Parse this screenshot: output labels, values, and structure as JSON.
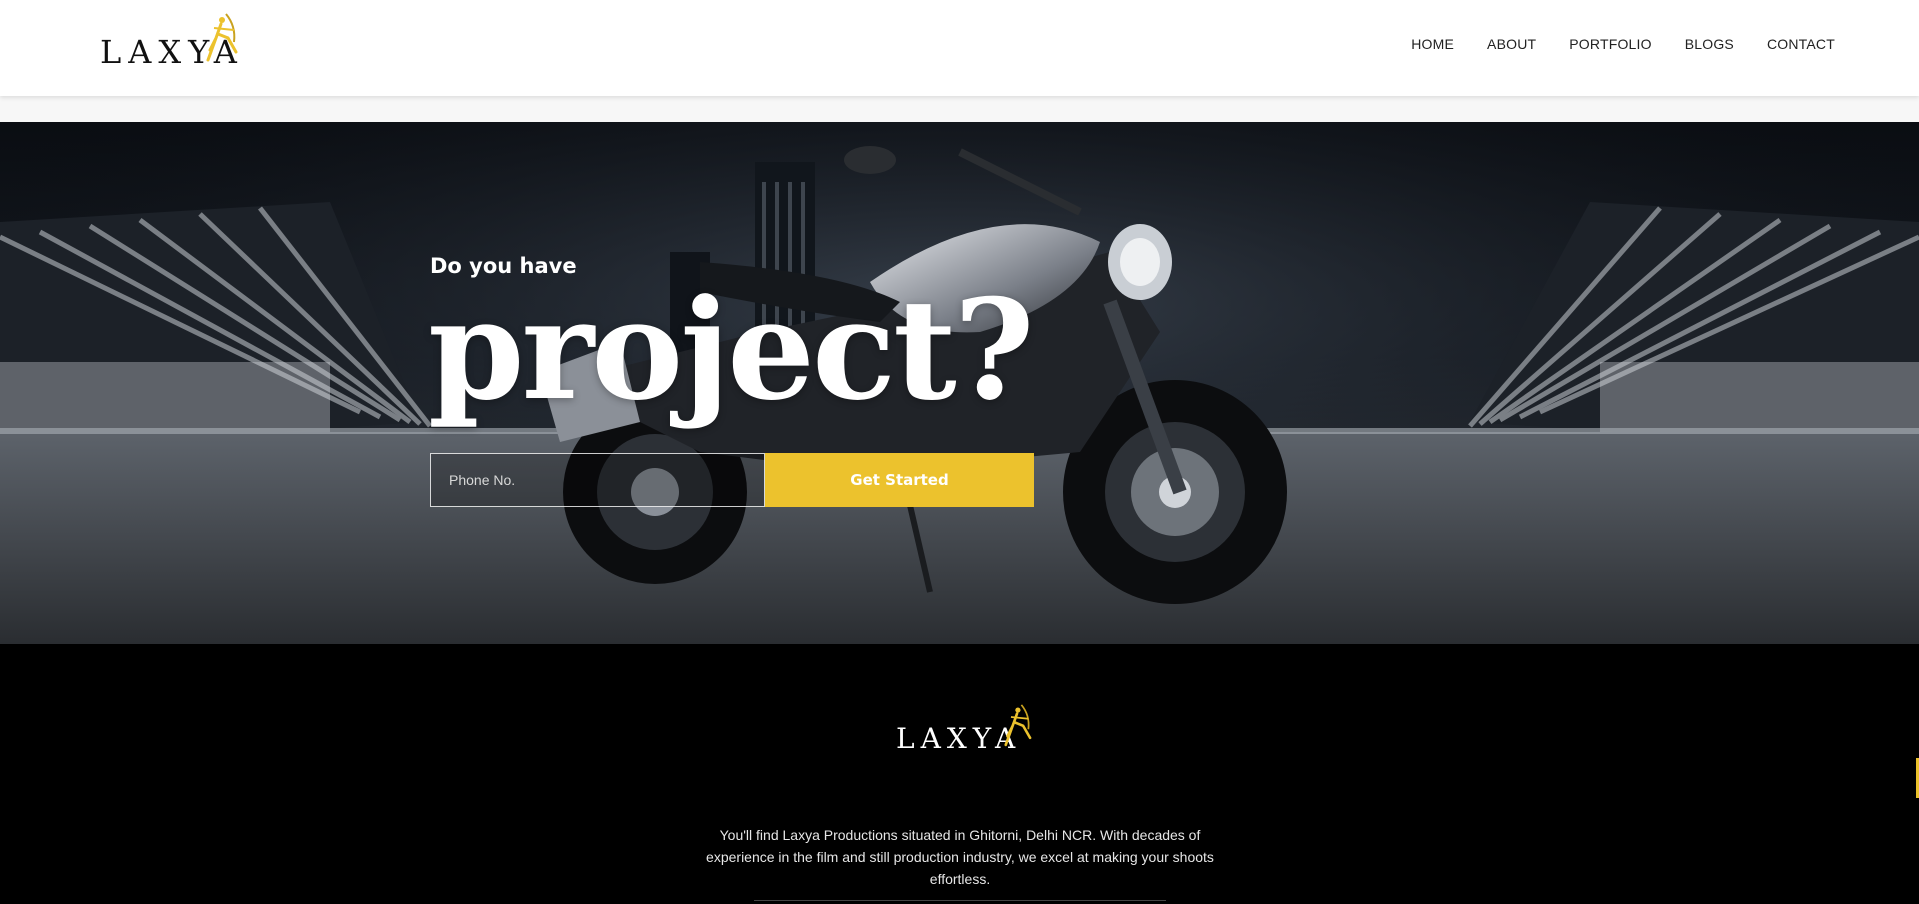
{
  "brand": {
    "logo_text": "LAXYA",
    "accent_color": "#ecc22d",
    "logo_icon": "archer-figure-icon"
  },
  "nav": {
    "items": [
      {
        "label": "HOME"
      },
      {
        "label": "ABOUT"
      },
      {
        "label": "PORTFOLIO"
      },
      {
        "label": "BLOGS"
      },
      {
        "label": "CONTACT"
      }
    ]
  },
  "hero": {
    "subtitle": "Do you have",
    "title": "project?",
    "background_image": "motorcycle-night-scene",
    "phone_placeholder": "Phone No.",
    "cta_label": "Get Started"
  },
  "footer": {
    "logo_text": "LAXYA",
    "description": "You'll find Laxya Productions situated in Ghitorni, Delhi NCR. With decades of experience in the film and still production industry, we excel at making your shoots effortless."
  }
}
